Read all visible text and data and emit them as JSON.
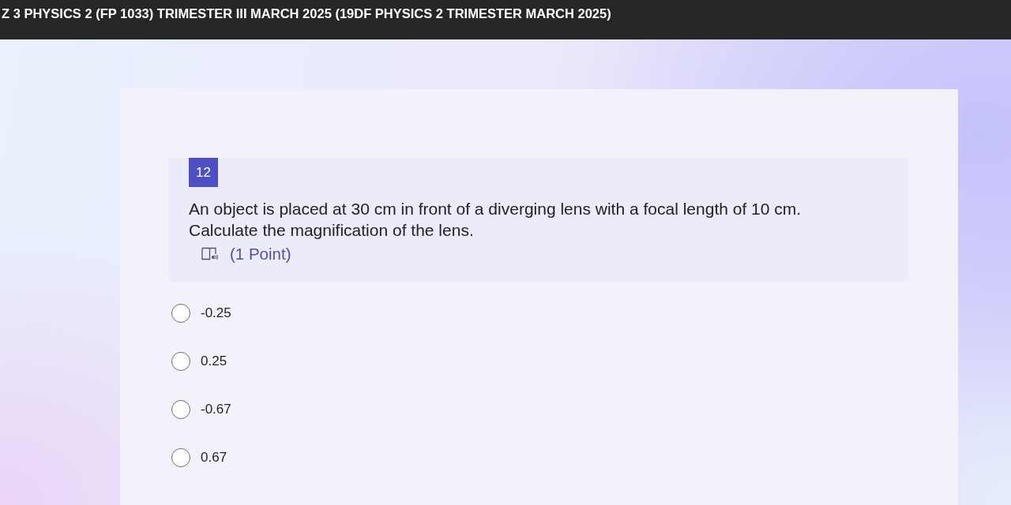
{
  "header": {
    "title": "Z 3 PHYSICS 2 (FP 1033) TRIMESTER III MARCH 2025 (19DF PHYSICS 2 TRIMESTER MARCH 2025)"
  },
  "question": {
    "number": "12",
    "text": "An object is placed at 30 cm in front of a diverging lens with a focal length of 10 cm.\nCalculate the magnification of the lens.",
    "points": "(1 Point)"
  },
  "options": [
    {
      "label": "-0.25",
      "selected": false
    },
    {
      "label": "0.25",
      "selected": false
    },
    {
      "label": "-0.67",
      "selected": false
    },
    {
      "label": "0.67",
      "selected": false
    }
  ]
}
